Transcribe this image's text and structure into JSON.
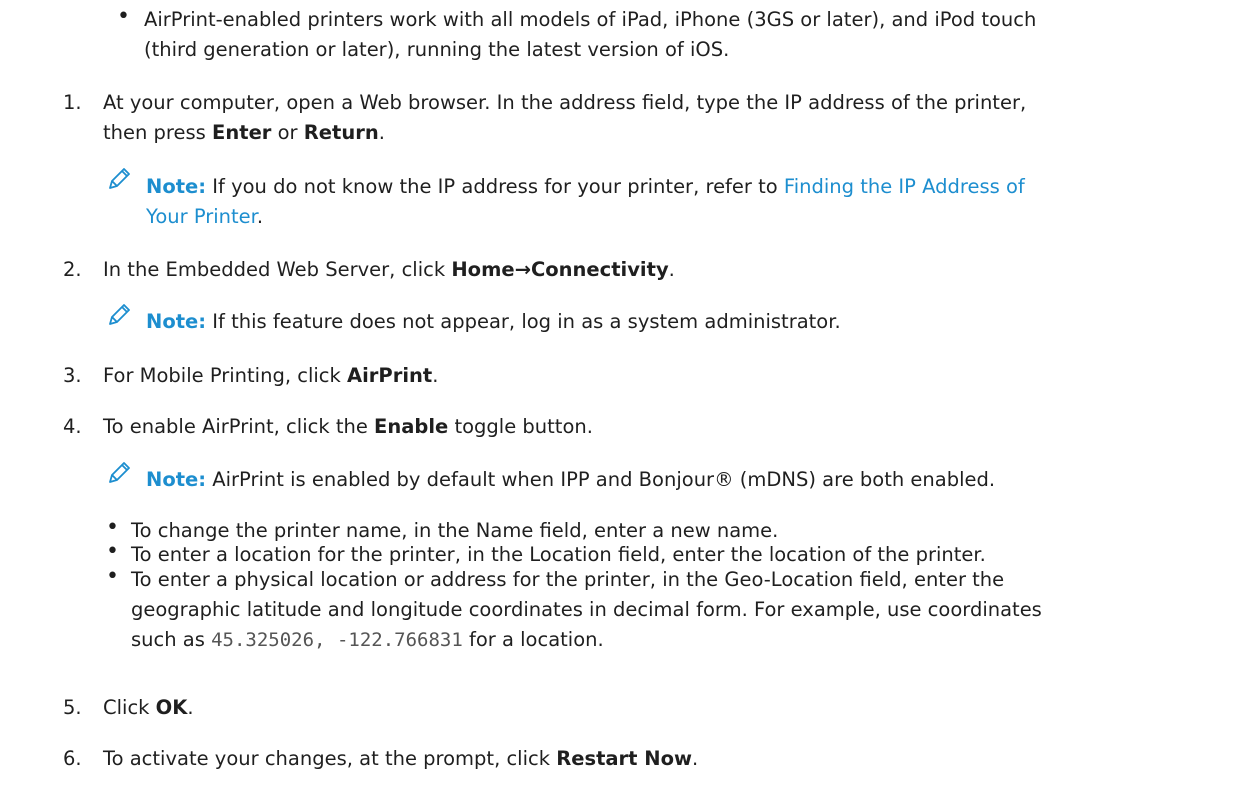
{
  "top_bullet": {
    "line1": "AirPrint-enabled printers work with all models of iPad, iPhone (3GS or later), and iPod touch",
    "line2": "(third generation or later), running the latest version of iOS."
  },
  "steps": [
    {
      "number": "1.",
      "line1_text": "At your computer, open a Web browser. In the address field, type the IP address of the printer,",
      "line2_pre": "then press ",
      "bold1": "Enter",
      "mid": " or ",
      "bold2": "Return",
      "post": "."
    },
    {
      "number": "2.",
      "pre": "In the Embedded Web Server, click ",
      "bold": "Home→Connectivity",
      "post": "."
    },
    {
      "number": "3.",
      "pre": "For Mobile Printing, click ",
      "bold": "AirPrint",
      "post": "."
    },
    {
      "number": "4.",
      "pre": "To enable AirPrint, click the ",
      "bold": "Enable",
      "post": " toggle button."
    },
    {
      "number": "5.",
      "pre": "Click ",
      "bold": "OK",
      "post": "."
    },
    {
      "number": "6.",
      "pre": "To activate your changes, at the prompt, click ",
      "bold": "Restart Now",
      "post": "."
    }
  ],
  "notes": [
    {
      "label": "Note:",
      "text": " If you do not know the IP address for your printer, refer to ",
      "link_line1": "Finding the IP Address of",
      "link_line2": "Your Printer",
      "post": "."
    },
    {
      "label": "Note:",
      "text": " If this feature does not appear, log in as a system administrator."
    },
    {
      "label": "Note:",
      "text": " AirPrint is enabled by default when IPP and Bonjour® (mDNS) are both enabled."
    }
  ],
  "sub_bullets": [
    {
      "text": "To change the printer name, in the Name field, enter a new name."
    },
    {
      "text": "To enter a location for the printer, in the Location field, enter the location of the printer."
    },
    {
      "line1": "To enter a physical location or address for the printer, in the Geo-Location field, enter the",
      "line2": "geographic latitude and longitude coordinates in decimal form. For example, use coordinates",
      "line3_pre": "such as ",
      "code": "45.325026, -122.766831",
      "line3_post": " for a location."
    }
  ],
  "icons": {
    "note": "pencil-icon"
  },
  "colors": {
    "accent": "#1d8ecf",
    "text": "#1f1f1f"
  }
}
